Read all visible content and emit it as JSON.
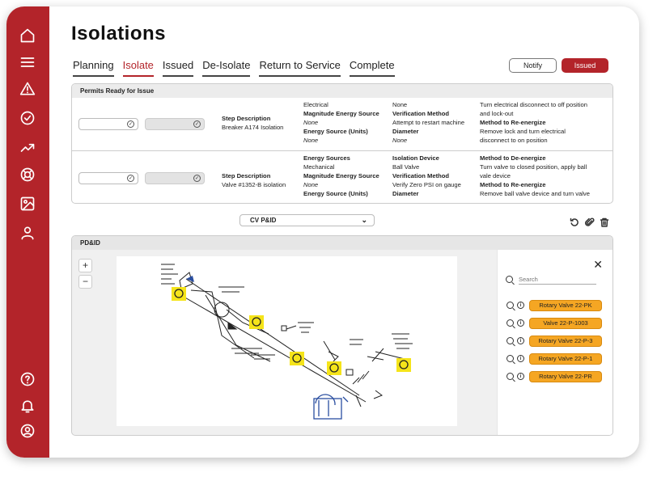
{
  "page_title": "Isolations",
  "tabs": [
    {
      "label": "Planning",
      "active": false
    },
    {
      "label": "Isolate",
      "active": true
    },
    {
      "label": "Issued",
      "active": false
    },
    {
      "label": "De-Isolate",
      "active": false
    },
    {
      "label": "Return to Service",
      "active": false
    },
    {
      "label": "Complete",
      "active": false
    }
  ],
  "actions": {
    "notify_label": "Notify",
    "issued_label": "Issued"
  },
  "sidebar_icons": [
    "home-icon",
    "menu-icon",
    "warning-icon",
    "check-circle-icon",
    "trending-icon",
    "lifebuoy-icon",
    "image-icon",
    "user-icon",
    "help-icon",
    "bell-icon",
    "account-icon"
  ],
  "permits": {
    "title": "Permits Ready for Issue",
    "rows": [
      {
        "step_label": "Step Description",
        "step_value": "Breaker A174 Isolation",
        "col1": [
          {
            "text": "Electrical",
            "style": "normal"
          },
          {
            "text": "Magnitude Energy Source",
            "style": "bold"
          },
          {
            "text": "None",
            "style": "italic"
          },
          {
            "text": "Energy Source (Units)",
            "style": "bold"
          },
          {
            "text": "None",
            "style": "italic"
          }
        ],
        "col2": [
          {
            "text": "None",
            "style": "normal"
          },
          {
            "text": "Verification Method",
            "style": "bold"
          },
          {
            "text": "Attempt to restart machine",
            "style": "normal"
          },
          {
            "text": "Diameter",
            "style": "bold"
          },
          {
            "text": "None",
            "style": "italic"
          }
        ],
        "col3": [
          {
            "text": "Turn electrical disconnect to off position",
            "style": "normal"
          },
          {
            "text": "and lock-out",
            "style": "normal"
          },
          {
            "text": "Method to Re-energize",
            "style": "bold"
          },
          {
            "text": "Remove lock and turn electrical",
            "style": "normal"
          },
          {
            "text": "disconnect to on position",
            "style": "normal"
          }
        ]
      },
      {
        "step_label": "Step Description",
        "step_value": "Valve #1352-B isolation",
        "col1": [
          {
            "text": "Energy Sources",
            "style": "bold"
          },
          {
            "text": "Mechanical",
            "style": "normal"
          },
          {
            "text": "Magnitude Energy Source",
            "style": "bold"
          },
          {
            "text": "None",
            "style": "italic"
          },
          {
            "text": "Energy Source (Units)",
            "style": "bold"
          }
        ],
        "col2": [
          {
            "text": "Isolation Device",
            "style": "bold"
          },
          {
            "text": "Ball Valve",
            "style": "normal"
          },
          {
            "text": "Verification Method",
            "style": "bold"
          },
          {
            "text": "Verify Zero PSI on gauge",
            "style": "normal"
          },
          {
            "text": "Diameter",
            "style": "bold"
          }
        ],
        "col3": [
          {
            "text": "Method to De-energize",
            "style": "bold"
          },
          {
            "text": "Turn valve to closed position, apply ball",
            "style": "normal"
          },
          {
            "text": "vale device",
            "style": "normal"
          },
          {
            "text": "Method to Re-energize",
            "style": "bold"
          },
          {
            "text": "Remove ball valve device and turn valve",
            "style": "normal"
          }
        ]
      }
    ]
  },
  "diagram_select": {
    "selected": "CV P&ID"
  },
  "pid_panel": {
    "title": "PD&ID",
    "zoom_in": "+",
    "zoom_out": "−",
    "close": "✕",
    "search_placeholder": "Search",
    "valves": [
      "Rotary Valve 22-PK",
      "Valve 22-P-1003",
      "Rotary Valve 22-P-3",
      "Rotary Valve 22-P-1",
      "Rotary Valve 22-PR"
    ]
  },
  "colors": {
    "brand_red": "#b3242a",
    "highlight_yellow": "#f5e41a",
    "valve_orange": "#f5a623",
    "diagram_blue": "#2a4ea0"
  }
}
